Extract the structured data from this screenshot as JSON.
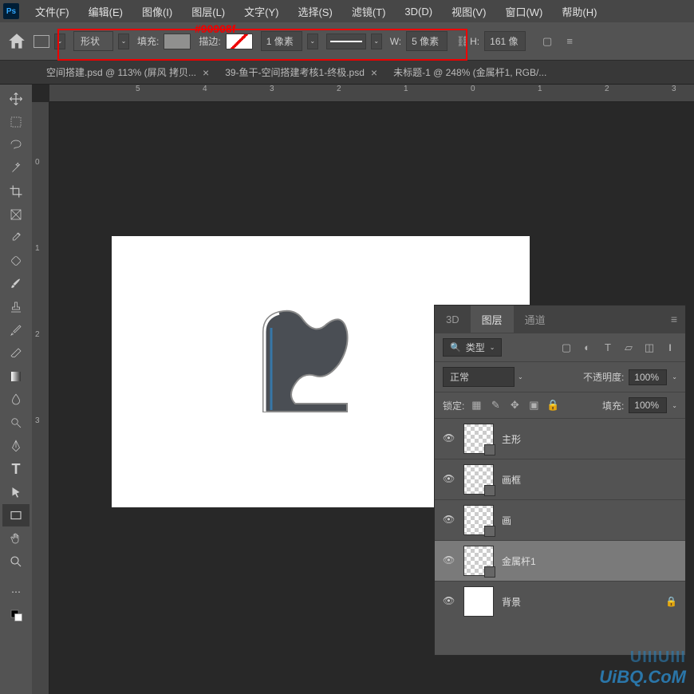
{
  "menubar": [
    "文件(F)",
    "编辑(E)",
    "图像(I)",
    "图层(L)",
    "文字(Y)",
    "选择(S)",
    "滤镜(T)",
    "3D(D)",
    "视图(V)",
    "窗口(W)",
    "帮助(H)"
  ],
  "annotation": "#90908f",
  "options": {
    "shape_mode": "形状",
    "fill_label": "填充:",
    "stroke_label": "描边:",
    "stroke_width": "1 像素",
    "w_label": "W:",
    "w_value": "5 像素",
    "h_label": "H:",
    "h_value": "161 像"
  },
  "tabs": [
    {
      "label": "空间搭建.psd @ 113% (屏风 拷贝..."
    },
    {
      "label": "39-鱼干-空间搭建考核1-终极.psd"
    },
    {
      "label": "未标题-1 @ 248% (金属杆1, RGB/..."
    }
  ],
  "ruler_top": [
    "5",
    "4",
    "3",
    "2",
    "1",
    "0",
    "1",
    "2",
    "3"
  ],
  "ruler_left": [
    "0",
    "1",
    "2",
    "3"
  ],
  "panel": {
    "tabs": [
      "3D",
      "图层",
      "通道"
    ],
    "filter_label": "类型",
    "blend_mode": "正常",
    "opacity_label": "不透明度:",
    "opacity_value": "100%",
    "lock_label": "锁定:",
    "fill_label": "填充:",
    "fill_value": "100%"
  },
  "layers": [
    {
      "name": "主形"
    },
    {
      "name": "画框"
    },
    {
      "name": "画"
    },
    {
      "name": "金属杆1"
    },
    {
      "name": "背景"
    }
  ],
  "watermark": {
    "line1": "UIIIUIII",
    "line2": "UiBQ.CoM"
  }
}
